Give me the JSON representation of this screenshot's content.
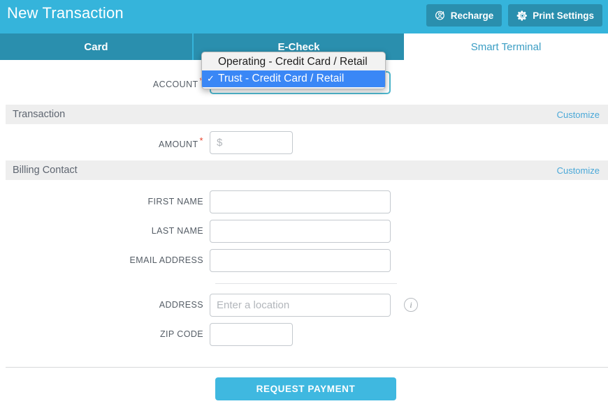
{
  "header": {
    "title": "New Transaction",
    "buttons": [
      {
        "label": "Recharge",
        "icon": "user-recharge-icon"
      },
      {
        "label": "Print Settings",
        "icon": "gear-icon"
      }
    ]
  },
  "tabs": [
    {
      "label": "Card",
      "active": false
    },
    {
      "label": "E-Check",
      "active": false
    },
    {
      "label": "Smart Terminal",
      "active": true
    }
  ],
  "account": {
    "label": "ACCOUNT",
    "required_marker": "*",
    "dropdown_open": true,
    "options": [
      {
        "label": "Operating - Credit Card / Retail",
        "selected": false
      },
      {
        "label": "Trust - Credit Card / Retail",
        "selected": true
      }
    ],
    "check_glyph": "✓"
  },
  "sections": {
    "transaction": {
      "title": "Transaction",
      "customize_label": "Customize",
      "amount": {
        "label": "AMOUNT",
        "required_marker": "*",
        "placeholder": "$",
        "value": ""
      }
    },
    "billing": {
      "title": "Billing Contact",
      "customize_label": "Customize",
      "fields": [
        {
          "label": "FIRST NAME",
          "placeholder": "",
          "value": ""
        },
        {
          "label": "LAST NAME",
          "placeholder": "",
          "value": ""
        },
        {
          "label": "EMAIL ADDRESS",
          "placeholder": "",
          "value": ""
        },
        {
          "label": "ADDRESS",
          "placeholder": "Enter a location",
          "value": ""
        },
        {
          "label": "ZIP CODE",
          "placeholder": "",
          "value": ""
        }
      ],
      "address_info_icon": "info-icon",
      "address_info_glyph": "i"
    }
  },
  "submit": {
    "label": "REQUEST PAYMENT"
  },
  "colors": {
    "header_blue": "#35b4db",
    "tab_inactive": "#2a8fae",
    "tab_active_text": "#3b9ec4",
    "link_blue": "#4aa8d8",
    "submit_blue": "#3fb8e0",
    "band_gray": "#eeeeee",
    "required_red": "#e8402a",
    "dropdown_highlight": "#3a87f6",
    "select_focus_border": "#4fb8cf"
  }
}
